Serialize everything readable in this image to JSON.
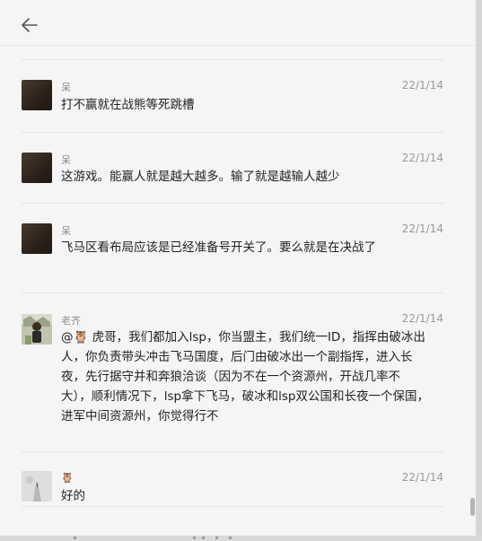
{
  "header": {
    "back_icon": "arrow-left-icon"
  },
  "messages": [
    {
      "sender": "呆",
      "time": "22/1/14",
      "avatar": "dark-avatar",
      "text": "打不赢就在战熊等死跳槽"
    },
    {
      "sender": "呆",
      "time": "22/1/14",
      "avatar": "dark-avatar",
      "text": "这游戏。能赢人就是越大越多。输了就是越输人越少"
    },
    {
      "sender": "呆",
      "time": "22/1/14",
      "avatar": "dark-avatar",
      "text": "飞马区看布局应该是已经准备号开关了。要么就是在决战了"
    },
    {
      "sender": "老齐",
      "time": "22/1/14",
      "avatar": "person-avatar",
      "text": "@🦉 虎哥，我们都加入lsp，你当盟主，我们统一ID，指挥由破冰出人，你负责带头冲击飞马国度，后门由破冰出一个副指挥，进入长夜，先行据守并和奔狼洽谈（因为不在一个资源州，开战几率不大），顺利情况下，lsp拿下飞马，破冰和lsp双公国和长夜一个保国，进军中间资源州，你觉得行不"
    },
    {
      "sender": "🦉",
      "time": "22/1/14",
      "avatar": "road-avatar",
      "text": "好的"
    }
  ]
}
